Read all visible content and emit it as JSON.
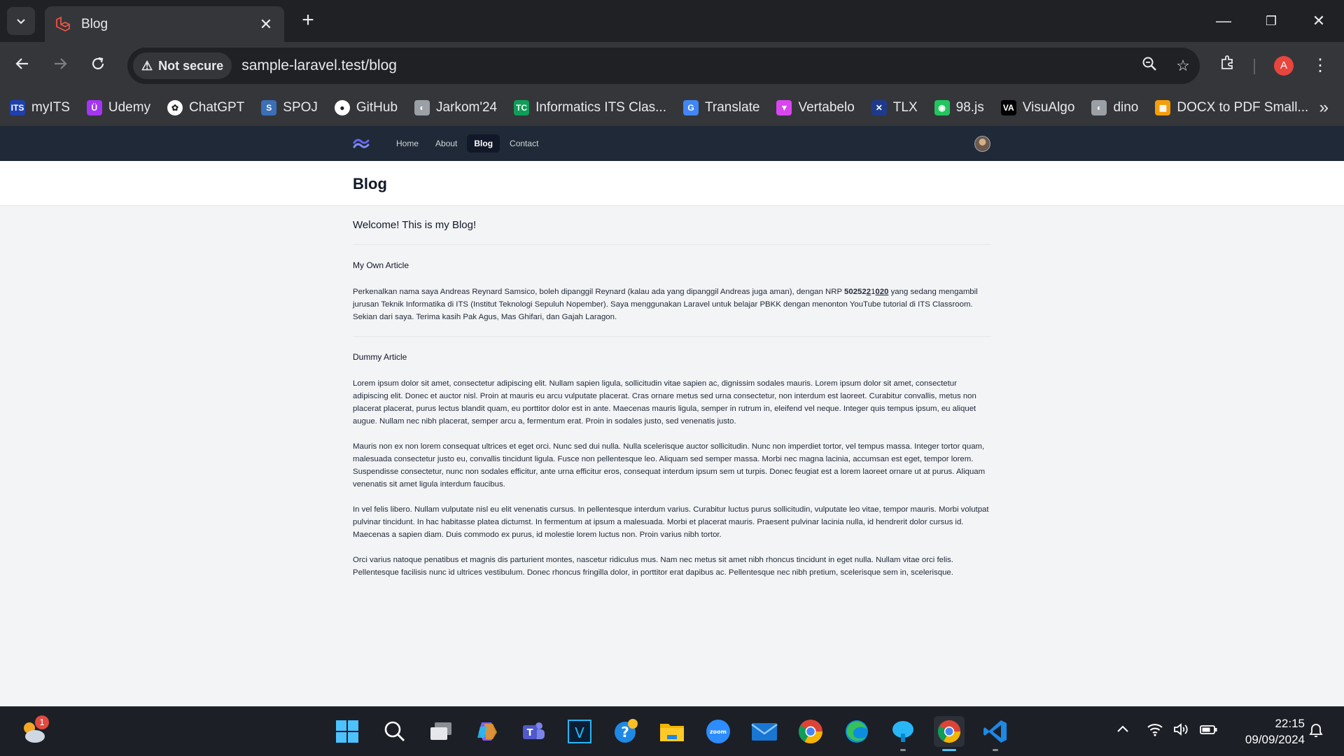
{
  "browser": {
    "tab_title": "Blog",
    "security_label": "Not secure",
    "url": "sample-laravel.test/blog",
    "bookmarks": [
      {
        "label": "myITS",
        "icon": "its-icon",
        "color": "#1e40af"
      },
      {
        "label": "Udemy",
        "icon": "udemy-icon",
        "color": "#a435f0"
      },
      {
        "label": "ChatGPT",
        "icon": "chatgpt-icon",
        "color": "#ffffff"
      },
      {
        "label": "SPOJ",
        "icon": "spoj-icon",
        "color": "#3b6fb6"
      },
      {
        "label": "GitHub",
        "icon": "github-icon",
        "color": "#ffffff"
      },
      {
        "label": "Jarkom'24",
        "icon": "globe-icon",
        "color": "#9aa0a6"
      },
      {
        "label": "Informatics ITS Clas...",
        "icon": "tc-icon",
        "color": "#0f9d58"
      },
      {
        "label": "Translate",
        "icon": "translate-icon",
        "color": "#4285f4"
      },
      {
        "label": "Vertabelo",
        "icon": "vertabelo-icon",
        "color": "#d946ef"
      },
      {
        "label": "TLX",
        "icon": "tlx-icon",
        "color": "#1e3a8a"
      },
      {
        "label": "98.js",
        "icon": "windows98-icon",
        "color": "#22c55e"
      },
      {
        "label": "VisuAlgo",
        "icon": "visualgo-icon",
        "color": "#000000"
      },
      {
        "label": "dino",
        "icon": "globe-icon",
        "color": "#9aa0a6"
      },
      {
        "label": "DOCX to PDF Small...",
        "icon": "smallpdf-icon",
        "color": "#f59e0b"
      }
    ]
  },
  "site": {
    "nav": [
      {
        "label": "Home",
        "active": false
      },
      {
        "label": "About",
        "active": false
      },
      {
        "label": "Blog",
        "active": true
      },
      {
        "label": "Contact",
        "active": false
      }
    ],
    "page_title": "Blog",
    "welcome": "Welcome! This is my Blog!",
    "articles": [
      {
        "title": "My Own Article",
        "paragraphs": [
          {
            "before": "Perkenalkan nama saya Andreas Reynard Samsico, boleh dipanggil Reynard (kalau ada yang dipanggil Andreas juga aman), dengan NRP ",
            "nrp_a": "50252",
            "nrp_b": "2",
            "nrp_c": "1",
            "nrp_d": "020",
            "after": " yang sedang mengambil jurusan Teknik Informatika di ITS (Institut Teknologi Sepuluh Nopember). Saya menggunakan Laravel untuk belajar PBKK dengan menonton YouTube tutorial di ITS Classroom. Sekian dari saya. Terima kasih Pak Agus, Mas Ghifari, dan Gajah Laragon."
          }
        ]
      },
      {
        "title": "Dummy Article",
        "paragraphs": [
          "Lorem ipsum dolor sit amet, consectetur adipiscing elit. Nullam sapien ligula, sollicitudin vitae sapien ac, dignissim sodales mauris. Lorem ipsum dolor sit amet, consectetur adipiscing elit. Donec et auctor nisl. Proin at mauris eu arcu vulputate placerat. Cras ornare metus sed urna consectetur, non interdum est laoreet. Curabitur convallis, metus non placerat placerat, purus lectus blandit quam, eu porttitor dolor est in ante. Maecenas mauris ligula, semper in rutrum in, eleifend vel neque. Integer quis tempus ipsum, eu aliquet augue. Nullam nec nibh placerat, semper arcu a, fermentum erat. Proin in sodales justo, sed venenatis justo.",
          "Mauris non ex non lorem consequat ultrices et eget orci. Nunc sed dui nulla. Nulla scelerisque auctor sollicitudin. Nunc non imperdiet tortor, vel tempus massa. Integer tortor quam, malesuada consectetur justo eu, convallis tincidunt ligula. Fusce non pellentesque leo. Aliquam sed semper massa. Morbi nec magna lacinia, accumsan est eget, tempor lorem. Suspendisse consectetur, nunc non sodales efficitur, ante urna efficitur eros, consequat interdum ipsum sem ut turpis. Donec feugiat est a lorem laoreet ornare ut at purus. Aliquam venenatis sit amet ligula interdum faucibus.",
          "In vel felis libero. Nullam vulputate nisl eu elit venenatis cursus. In pellentesque interdum varius. Curabitur luctus purus sollicitudin, vulputate leo vitae, tempor mauris. Morbi volutpat pulvinar tincidunt. In hac habitasse platea dictumst. In fermentum at ipsum a malesuada. Morbi et placerat mauris. Praesent pulvinar lacinia nulla, id hendrerit dolor cursus id. Maecenas a sapien diam. Duis commodo ex purus, id molestie lorem luctus non. Proin varius nibh tortor.",
          "Orci varius natoque penatibus et magnis dis parturient montes, nascetur ridiculus mus. Nam nec metus sit amet nibh rhoncus tincidunt in eget nulla. Nullam vitae orci felis. Pellentesque facilisis nunc id ultrices vestibulum. Donec rhoncus fringilla dolor, in porttitor erat dapibus ac. Pellentesque nec nibh pretium, scelerisque sem in, scelerisque."
        ]
      }
    ]
  },
  "taskbar": {
    "weather_badge": "1",
    "time": "22:15",
    "date": "09/09/2024",
    "profile_initial": "A"
  },
  "colors": {
    "nav_bg": "#1f2937",
    "page_bg": "#f3f4f6",
    "chrome_bg": "#35363a"
  }
}
